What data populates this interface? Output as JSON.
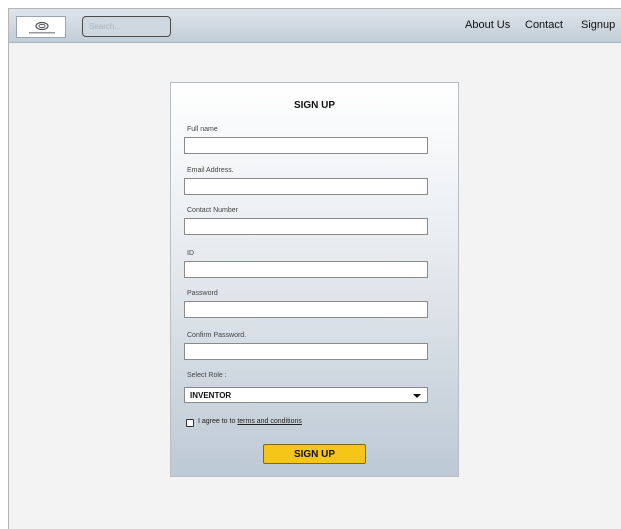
{
  "header": {
    "search": {
      "placeholder": "Search..."
    },
    "nav": [
      {
        "label": "About Us"
      },
      {
        "label": "Contact"
      },
      {
        "label": "Signup"
      }
    ]
  },
  "form": {
    "title": "SIGN UP",
    "fields": [
      {
        "label": "Full name",
        "value": ""
      },
      {
        "label": "Email Address.",
        "value": ""
      },
      {
        "label": "Contact Number",
        "value": ""
      },
      {
        "label": "ID",
        "value": ""
      },
      {
        "label": "Password",
        "value": ""
      },
      {
        "label": "Confirm Password.",
        "value": ""
      }
    ],
    "role": {
      "label": "Select Role :",
      "selected": "INVENTOR"
    },
    "terms": {
      "prefix": "I agree to to ",
      "link": "terms and conditions",
      "checked": false
    },
    "submit_label": "SIGN UP"
  },
  "colors": {
    "accent": "#f5c518",
    "nav_background": "#c2cdd7"
  }
}
